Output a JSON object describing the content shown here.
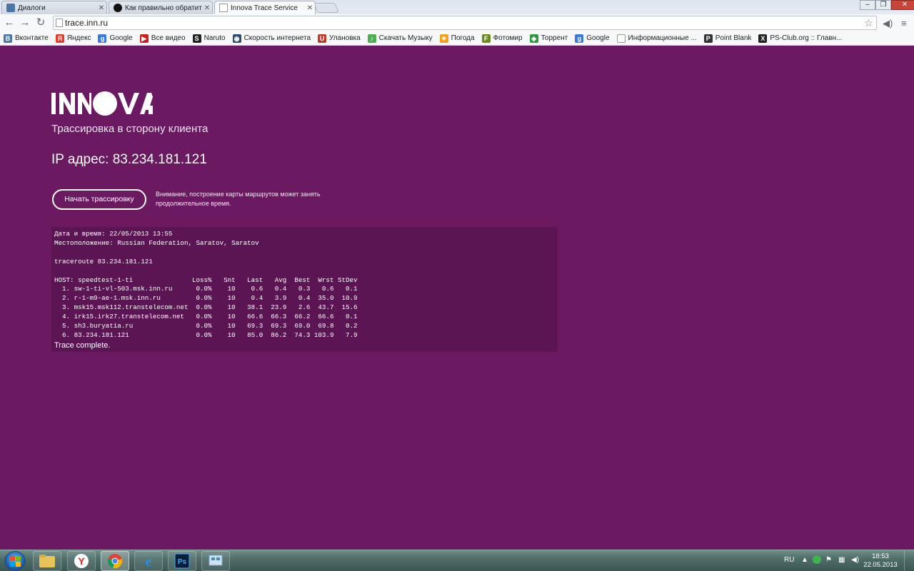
{
  "tabs": [
    {
      "title": "Диалоги",
      "icon": "vk-icon",
      "color": "#4a76a8"
    },
    {
      "title": "Как правильно обратить",
      "icon": "paw-icon",
      "color": "#111111"
    },
    {
      "title": "Innova Trace Service",
      "icon": "page-icon",
      "color": "#ffffff"
    }
  ],
  "toolbar": {
    "url": "trace.inn.ru"
  },
  "bookmarks": [
    {
      "label": "Вконтакте",
      "icon": "vk-icon",
      "color": "#4a76a8",
      "glyph": "B"
    },
    {
      "label": "Яндекс",
      "icon": "yandex-icon",
      "color": "#e53b2c",
      "glyph": "Я"
    },
    {
      "label": "Google",
      "icon": "google-icon",
      "color": "#3a7be0",
      "glyph": "g"
    },
    {
      "label": "Все видео",
      "icon": "youtube-icon",
      "color": "#cc1f1f",
      "glyph": "▶"
    },
    {
      "label": "Naruto",
      "icon": "naruto-icon",
      "color": "#222222",
      "glyph": "S"
    },
    {
      "label": "Скорость интернета",
      "icon": "speedtest-icon",
      "color": "#2a4a6b",
      "glyph": "◉"
    },
    {
      "label": "Улановка",
      "icon": "ulanovka-icon",
      "color": "#c0392b",
      "glyph": "U"
    },
    {
      "label": "Скачать Музыку",
      "icon": "music-icon",
      "color": "#4caf50",
      "glyph": "♪"
    },
    {
      "label": "Погода",
      "icon": "weather-icon",
      "color": "#f0a020",
      "glyph": "☀"
    },
    {
      "label": "Фотомир",
      "icon": "photo-icon",
      "color": "#6d8a1f",
      "glyph": "F"
    },
    {
      "label": "Торрент",
      "icon": "torrent-icon",
      "color": "#2e9a3e",
      "glyph": "◆"
    },
    {
      "label": "Google",
      "icon": "google-icon",
      "color": "#3a7be0",
      "glyph": "g"
    },
    {
      "label": "Информационные ...",
      "icon": "page-icon",
      "color": "#cfd6df",
      "glyph": ""
    },
    {
      "label": "Point Blank",
      "icon": "pointblank-icon",
      "color": "#333333",
      "glyph": "P"
    },
    {
      "label": "PS-Club.org :: Главн...",
      "icon": "psclub-icon",
      "color": "#222222",
      "glyph": "X"
    }
  ],
  "page": {
    "brand": "INNOVA",
    "subtitle": "Трассировка в сторону клиента",
    "ip_line": "IP адрес: 83.234.181.121",
    "start_button": "Начать трассировку",
    "warning": "Внимание, построение карты маршрутов может занять продолжительное время.",
    "trace": {
      "datetime": "Дата и время: 22/05/2013 13:55",
      "location": "Местоположение: Russian Federation, Saratov, Saratov",
      "command": "traceroute 83.234.181.121",
      "header": "HOST: speedtest-1-ti               Loss%   Snt   Last   Avg  Best  Wrst StDev",
      "hops": [
        "  1. sw-1-ti-vl-503.msk.inn.ru      0.0%    10    0.6   0.4   0.3   0.6   0.1",
        "  2. r-1-m9-ae-1.msk.inn.ru         0.0%    10    0.4   3.9   0.4  35.0  10.9",
        "  3. msk15.msk112.transtelecom.net  0.0%    10   38.1  23.9   2.6  43.7  15.6",
        "  4. irk15.irk27.transtelecom.net   0.0%    10   66.6  66.3  66.2  66.6   0.1",
        "  5. sh3.buryatia.ru                0.0%    10   69.3  69.3  69.0  69.8   0.2",
        "  6. 83.234.181.121                 0.0%    10   85.0  86.2  74.3 103.9   7.9"
      ],
      "complete": "Trace complete."
    }
  },
  "taskbar": {
    "apps": [
      {
        "name": "explorer",
        "icon": "folder-icon",
        "active": false
      },
      {
        "name": "yandex",
        "icon": "yandex-browser-icon",
        "active": false
      },
      {
        "name": "chrome",
        "icon": "chrome-icon",
        "active": true
      },
      {
        "name": "ie",
        "icon": "ie-icon",
        "active": false
      },
      {
        "name": "photoshop",
        "icon": "photoshop-icon",
        "active": false,
        "label": "Ps"
      },
      {
        "name": "app",
        "icon": "app-window-icon",
        "active": false
      }
    ],
    "lang": "RU",
    "time": "18:53",
    "date": "22.05.2013"
  },
  "colors": {
    "page_bg": "#6b1a62",
    "console_bg": "#5a1552"
  }
}
